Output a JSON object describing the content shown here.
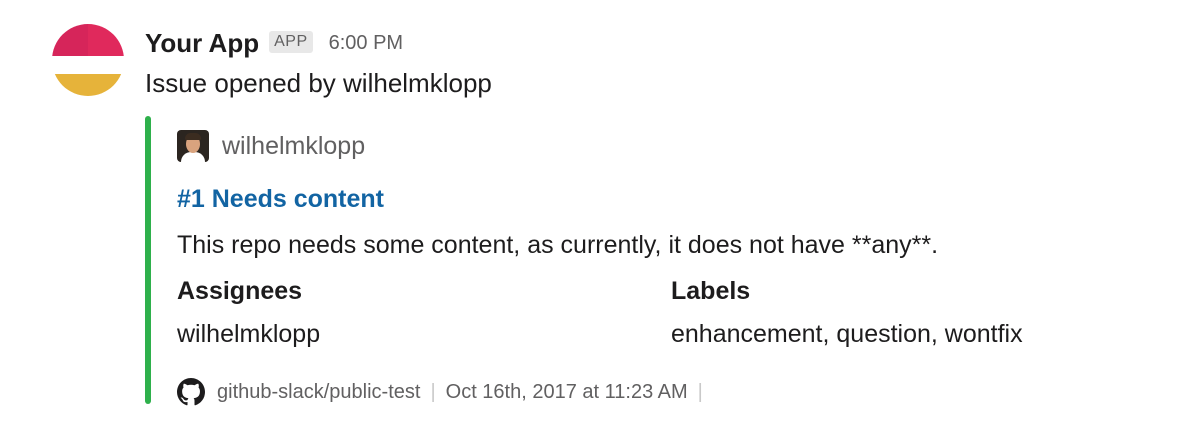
{
  "message": {
    "sender": "Your App",
    "badge": "APP",
    "time": "6:00 PM",
    "text": "Issue opened by wilhelmklopp",
    "avatar_icon": "app-logo-icon"
  },
  "attachment": {
    "accent_color": "#2eb04b",
    "author": "wilhelmklopp",
    "title": "#1 Needs content",
    "title_color": "#1264a3",
    "text": "This repo needs some content, as currently, it does not have **any**.",
    "fields": [
      {
        "title": "Assignees",
        "value": "wilhelmklopp"
      },
      {
        "title": "Labels",
        "value": "enhancement, question, wontfix"
      }
    ],
    "footer": {
      "icon": "github-icon",
      "repo": "github-slack/public-test",
      "timestamp": "Oct 16th, 2017 at 11:23 AM"
    }
  },
  "colors": {
    "avatar_red": "#d6255a",
    "avatar_pink": "#e0295c",
    "avatar_yellow": "#e6b33a"
  }
}
